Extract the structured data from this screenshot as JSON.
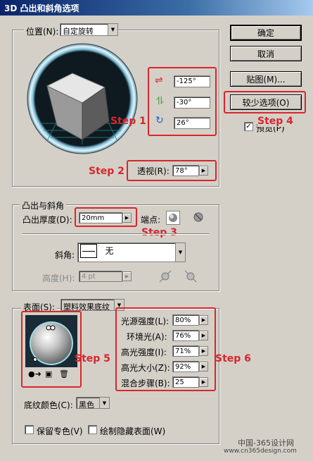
{
  "window": {
    "title": "3D 凸出和斜角选项"
  },
  "position": {
    "label": "位置(N):",
    "preset": "自定旋转",
    "rotate_x": "-125°",
    "rotate_y": "-30°",
    "rotate_z": "26°",
    "perspective_label": "透视(R):",
    "perspective": "78°"
  },
  "buttons": {
    "ok": "确定",
    "cancel": "取消",
    "map_art": "贴图(M)...",
    "fewer_options": "较少选项(O)",
    "preview": "预览(P)"
  },
  "extrude": {
    "group_label": "凸出与斜角",
    "depth_label": "凸出厚度(D):",
    "depth": "20mm",
    "cap_label": "端点:",
    "bevel_label": "斜角:",
    "bevel_value": "无",
    "height_label": "高度(H):",
    "height": "4 pt"
  },
  "surface": {
    "label": "表面(S):",
    "value": "塑料效果底纹",
    "light_intensity_label": "光源强度(L):",
    "light_intensity": "80%",
    "ambient_label": "环境光(A):",
    "ambient": "76%",
    "highlight_intensity_label": "高光强度(I):",
    "highlight_intensity": "71%",
    "highlight_size_label": "高光大小(Z):",
    "highlight_size": "92%",
    "blend_steps_label": "混合步骤(B):",
    "blend_steps": "25",
    "shading_color_label": "底纹颜色(C):",
    "shading_color": "黑色",
    "preserve_spot": "保留专色(V)",
    "draw_hidden": "绘制隐藏表面(W)"
  },
  "steps": {
    "s1": "Step 1",
    "s2": "Step 2",
    "s3": "Step 3",
    "s4": "Step 4",
    "s5": "Step 5",
    "s6": "Step 6"
  },
  "watermark": {
    "line1": "中国-365设计网",
    "line2": "www.cn365design.com"
  },
  "colors": {
    "annotation_red": "#d8262c",
    "title_blue": "#0a246a"
  }
}
